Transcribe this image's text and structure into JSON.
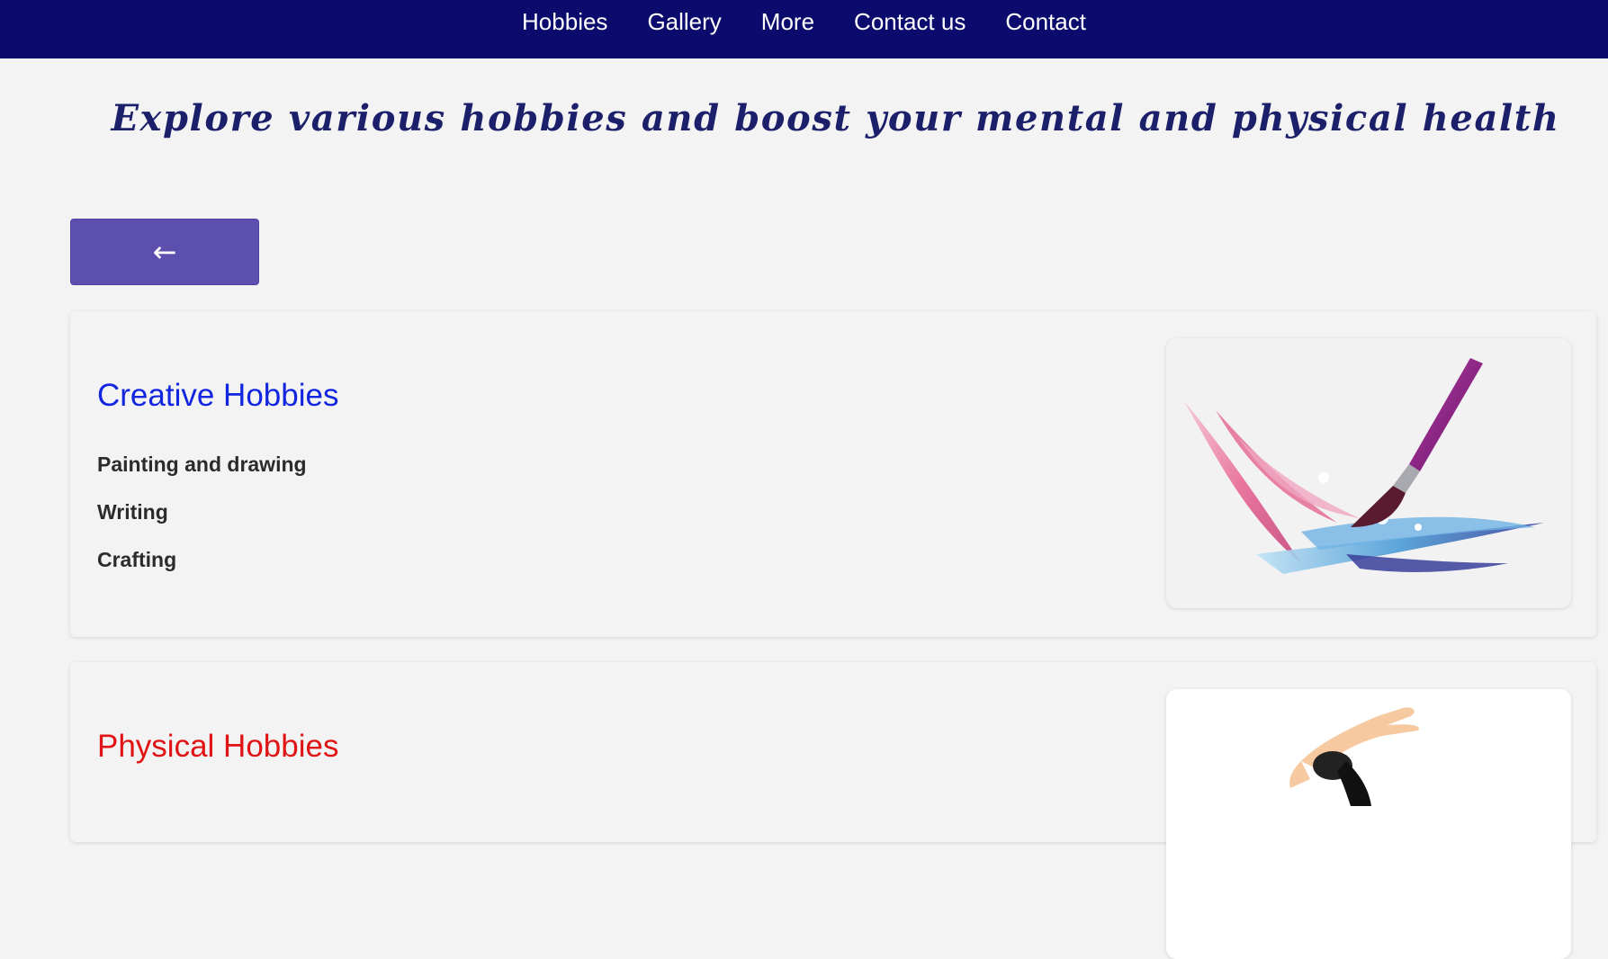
{
  "nav": {
    "items": [
      "Hobbies",
      "Gallery",
      "More",
      "Contact us",
      "Contact"
    ]
  },
  "headline": "Explore various hobbies and boost your mental and physical health",
  "back_button": {
    "label": "←"
  },
  "sections": [
    {
      "title": "Creative Hobbies",
      "title_color": "#1226e0",
      "items": [
        "Painting and drawing",
        "Writing",
        "Crafting"
      ],
      "image_icon": "paintbrush-icon"
    },
    {
      "title": "Physical Hobbies",
      "title_color": "#e01414",
      "image_icon": "stretching-figure-icon"
    }
  ],
  "colors": {
    "navbar": "#0b0b6e",
    "headline": "#1c1f6a",
    "back_button": "#5c4fae",
    "background": "#f3f3f4"
  }
}
